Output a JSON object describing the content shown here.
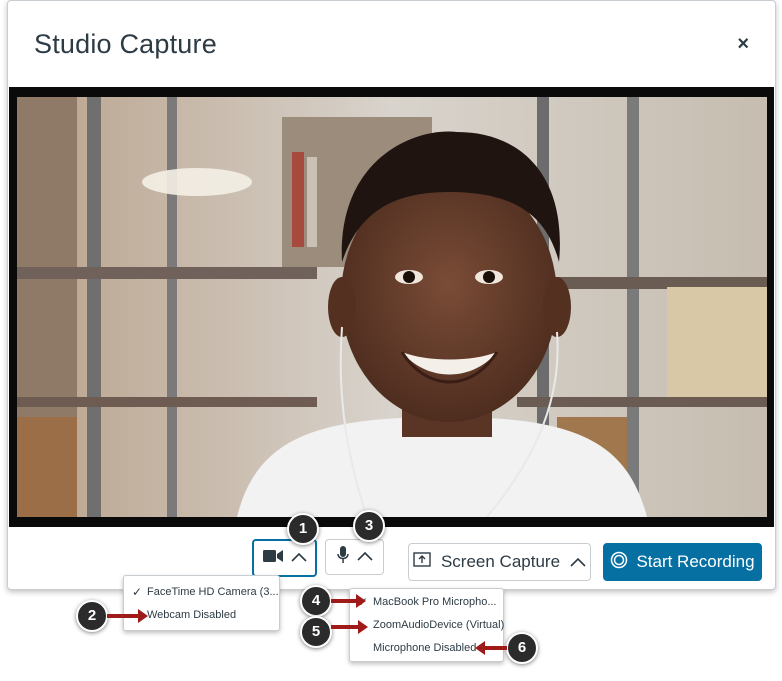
{
  "dialog": {
    "title": "Studio Capture",
    "close_label": "×"
  },
  "controls": {
    "camera_icon": "video-camera-icon",
    "microphone_icon": "microphone-icon",
    "chevron_icon": "chevron-up-icon",
    "screen_capture_label": "Screen Capture",
    "start_recording_label": "Start Recording",
    "accent_color": "#0770a3"
  },
  "camera_menu": {
    "items": [
      {
        "label": "FaceTime HD Camera (3...",
        "selected": true
      },
      {
        "label": "Webcam Disabled",
        "selected": false
      }
    ]
  },
  "microphone_menu": {
    "items": [
      {
        "label": "MacBook Pro Micropho...",
        "selected": true
      },
      {
        "label": "ZoomAudioDevice (Virtual)",
        "selected": false
      },
      {
        "label": "Microphone Disabled",
        "selected": false
      }
    ]
  },
  "callouts": [
    "1",
    "2",
    "3",
    "4",
    "5",
    "6"
  ]
}
